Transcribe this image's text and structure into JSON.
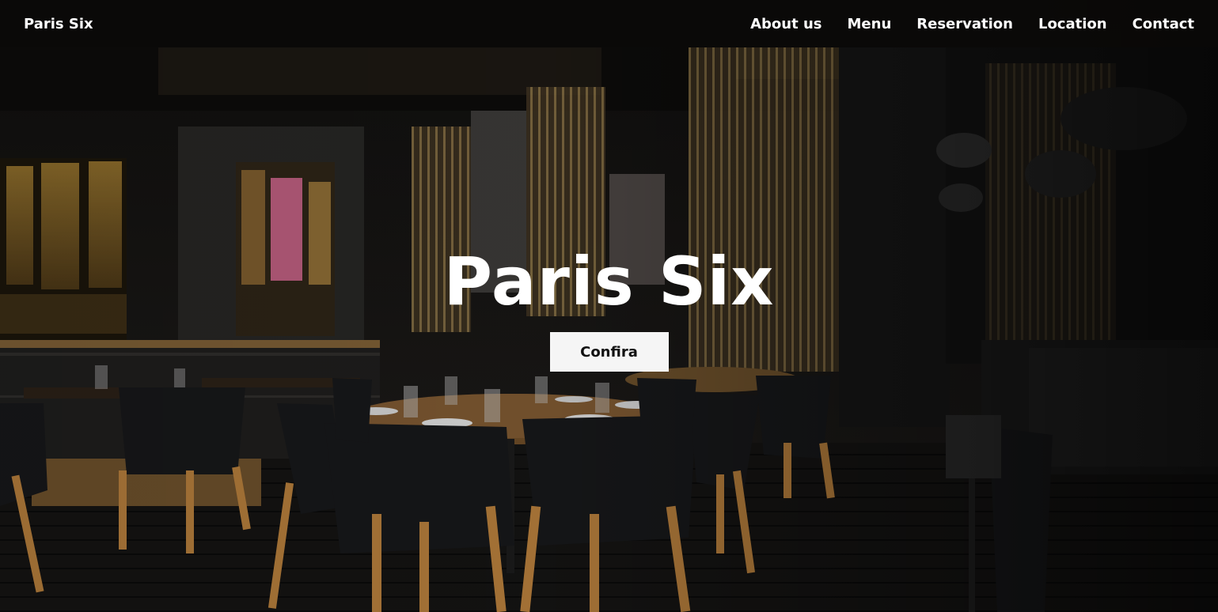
{
  "navbar": {
    "brand": "Paris Six",
    "links": [
      {
        "label": "About us"
      },
      {
        "label": "Menu"
      },
      {
        "label": "Reservation"
      },
      {
        "label": "Location"
      },
      {
        "label": "Contact"
      }
    ]
  },
  "hero": {
    "title": "Paris Six",
    "button_label": "Confira",
    "background": "restaurant-interior-photo"
  },
  "colors": {
    "nav_background": "#0a0908",
    "text": "#ffffff",
    "button_background": "#f5f5f5",
    "button_text": "#111111"
  }
}
